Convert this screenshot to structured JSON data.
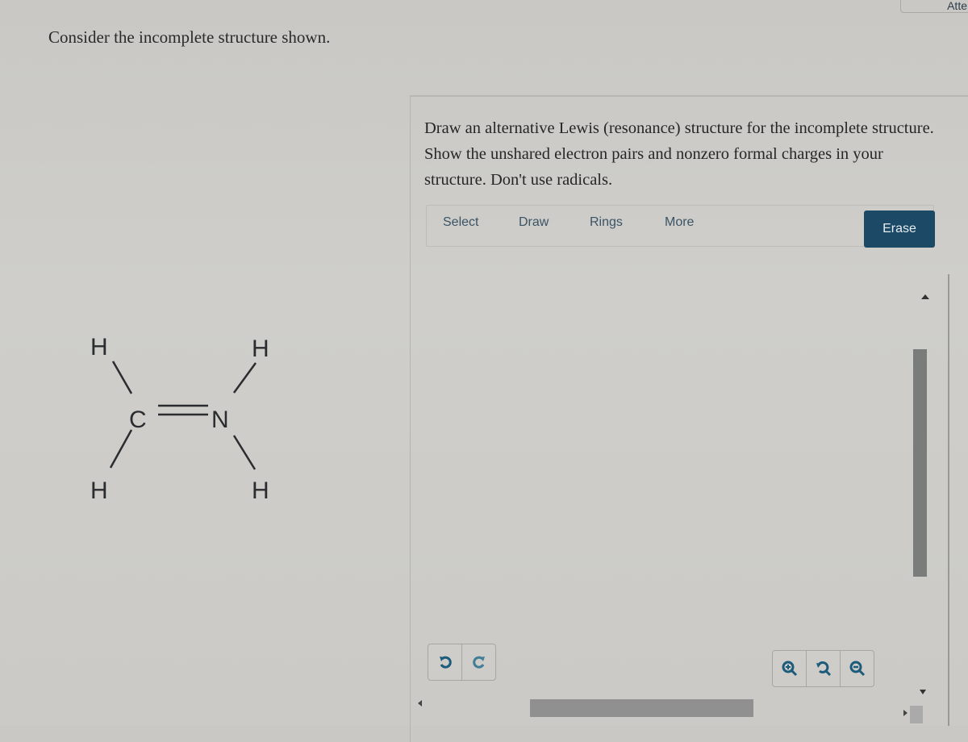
{
  "question": {
    "prompt": "Consider the incomplete structure shown.",
    "instructions": "Draw an alternative Lewis (resonance) structure for the incomplete structure. Show the unshared electron pairs and nonzero formal charges in your structure. Don't use radicals."
  },
  "header": {
    "corner_button_label": "Atte"
  },
  "molecule": {
    "atoms": {
      "c": "C",
      "n": "N",
      "h_top_left": "H",
      "h_bottom_left": "H",
      "h_top_right": "H",
      "h_bottom_right": "H"
    },
    "bonds": [
      {
        "from": "C",
        "to": "N",
        "order": 2
      },
      {
        "from": "C",
        "to": "H",
        "order": 1
      },
      {
        "from": "C",
        "to": "H",
        "order": 1
      },
      {
        "from": "N",
        "to": "H",
        "order": 1
      },
      {
        "from": "N",
        "to": "H",
        "order": 1
      }
    ]
  },
  "editor": {
    "tabs": [
      {
        "label": "Select"
      },
      {
        "label": "Draw"
      },
      {
        "label": "Rings"
      },
      {
        "label": "More"
      }
    ],
    "erase_label": "Erase",
    "undo_icon": "undo-icon",
    "redo_icon": "redo-icon",
    "zoom_in_icon": "zoom-in-icon",
    "reset_zoom_icon": "reset-zoom-icon",
    "zoom_out_icon": "zoom-out-icon"
  },
  "colors": {
    "accent": "#1c4a66",
    "icon": "#1d5b7a",
    "tab_text": "#3a5466"
  }
}
